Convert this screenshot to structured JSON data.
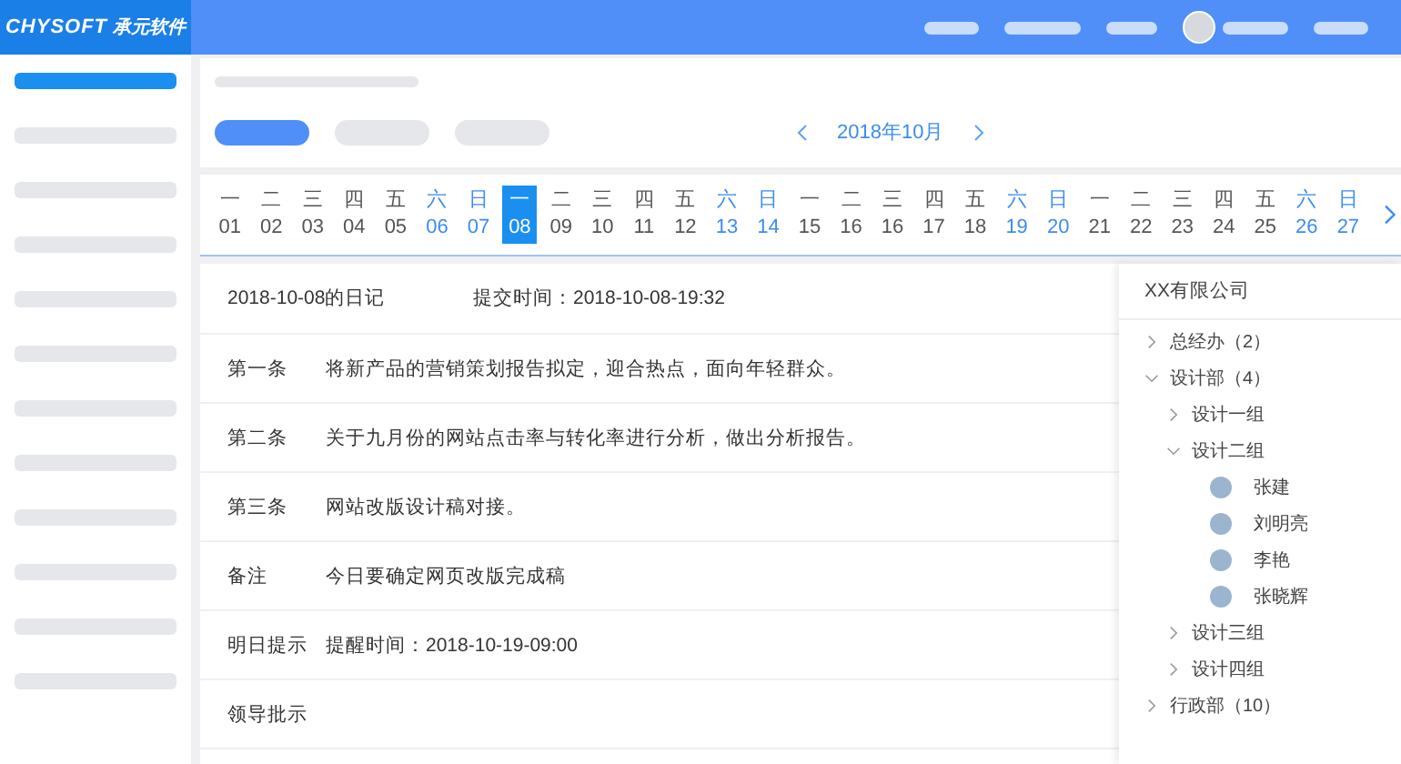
{
  "header": {
    "logo_latin": "CHYSOFT",
    "logo_cn": "承元软件"
  },
  "sidebar": {
    "items": [
      {
        "selected": true
      },
      {
        "selected": false
      },
      {
        "selected": false
      },
      {
        "selected": false
      },
      {
        "selected": false
      },
      {
        "selected": false
      },
      {
        "selected": false
      },
      {
        "selected": false
      },
      {
        "selected": false
      },
      {
        "selected": false
      },
      {
        "selected": false
      },
      {
        "selected": false
      }
    ]
  },
  "filter_tabs": [
    {
      "selected": true
    },
    {
      "selected": false
    },
    {
      "selected": false
    }
  ],
  "month_nav": {
    "label": "2018年10月"
  },
  "calendar": {
    "days": [
      {
        "weekday": "一",
        "day": "01",
        "weekend": false,
        "selected": false
      },
      {
        "weekday": "二",
        "day": "02",
        "weekend": false,
        "selected": false
      },
      {
        "weekday": "三",
        "day": "03",
        "weekend": false,
        "selected": false
      },
      {
        "weekday": "四",
        "day": "04",
        "weekend": false,
        "selected": false
      },
      {
        "weekday": "五",
        "day": "05",
        "weekend": false,
        "selected": false
      },
      {
        "weekday": "六",
        "day": "06",
        "weekend": true,
        "selected": false
      },
      {
        "weekday": "日",
        "day": "07",
        "weekend": true,
        "selected": false
      },
      {
        "weekday": "一",
        "day": "08",
        "weekend": false,
        "selected": true
      },
      {
        "weekday": "二",
        "day": "09",
        "weekend": false,
        "selected": false
      },
      {
        "weekday": "三",
        "day": "10",
        "weekend": false,
        "selected": false
      },
      {
        "weekday": "四",
        "day": "11",
        "weekend": false,
        "selected": false
      },
      {
        "weekday": "五",
        "day": "12",
        "weekend": false,
        "selected": false
      },
      {
        "weekday": "六",
        "day": "13",
        "weekend": true,
        "selected": false
      },
      {
        "weekday": "日",
        "day": "14",
        "weekend": true,
        "selected": false
      },
      {
        "weekday": "一",
        "day": "15",
        "weekend": false,
        "selected": false
      },
      {
        "weekday": "二",
        "day": "16",
        "weekend": false,
        "selected": false
      },
      {
        "weekday": "三",
        "day": "16",
        "weekend": false,
        "selected": false
      },
      {
        "weekday": "四",
        "day": "17",
        "weekend": false,
        "selected": false
      },
      {
        "weekday": "五",
        "day": "18",
        "weekend": false,
        "selected": false
      },
      {
        "weekday": "六",
        "day": "19",
        "weekend": true,
        "selected": false
      },
      {
        "weekday": "日",
        "day": "20",
        "weekend": true,
        "selected": false
      },
      {
        "weekday": "一",
        "day": "21",
        "weekend": false,
        "selected": false
      },
      {
        "weekday": "二",
        "day": "22",
        "weekend": false,
        "selected": false
      },
      {
        "weekday": "三",
        "day": "23",
        "weekend": false,
        "selected": false
      },
      {
        "weekday": "四",
        "day": "24",
        "weekend": false,
        "selected": false
      },
      {
        "weekday": "五",
        "day": "25",
        "weekend": false,
        "selected": false
      },
      {
        "weekday": "六",
        "day": "26",
        "weekend": true,
        "selected": false
      },
      {
        "weekday": "日",
        "day": "27",
        "weekend": true,
        "selected": false
      }
    ]
  },
  "diary": {
    "title": "2018-10-08的日记",
    "submitted": "提交时间：2018-10-08-19:32",
    "rows": [
      {
        "label": "第一条",
        "text": "将新产品的营销策划报告拟定，迎合热点，面向年轻群众。"
      },
      {
        "label": "第二条",
        "text": "关于九月份的网站点击率与转化率进行分析，做出分析报告。"
      },
      {
        "label": "第三条",
        "text": "网站改版设计稿对接。"
      },
      {
        "label": "备注",
        "text": "今日要确定网页改版完成稿"
      },
      {
        "label": "明日提示",
        "text": "提醒时间：2018-10-19-09:00"
      },
      {
        "label": "领导批示"
      }
    ]
  },
  "org_tree": {
    "title": "XX有限公司",
    "nodes": [
      {
        "kind": "group",
        "label": "总经办（2）",
        "expanded": false
      },
      {
        "kind": "group",
        "label": "设计部（4）",
        "expanded": true,
        "children": [
          {
            "kind": "group",
            "label": "设计一组",
            "expanded": false
          },
          {
            "kind": "group",
            "label": "设计二组",
            "expanded": true,
            "children": [
              {
                "kind": "person",
                "label": "张建"
              },
              {
                "kind": "person",
                "label": "刘明亮"
              },
              {
                "kind": "person",
                "label": "李艳"
              },
              {
                "kind": "person",
                "label": "张晓辉"
              }
            ]
          },
          {
            "kind": "group",
            "label": "设计三组",
            "expanded": false
          },
          {
            "kind": "group",
            "label": "设计四组",
            "expanded": false
          }
        ]
      },
      {
        "kind": "group",
        "label": "行政部（10）",
        "expanded": false
      }
    ]
  }
}
